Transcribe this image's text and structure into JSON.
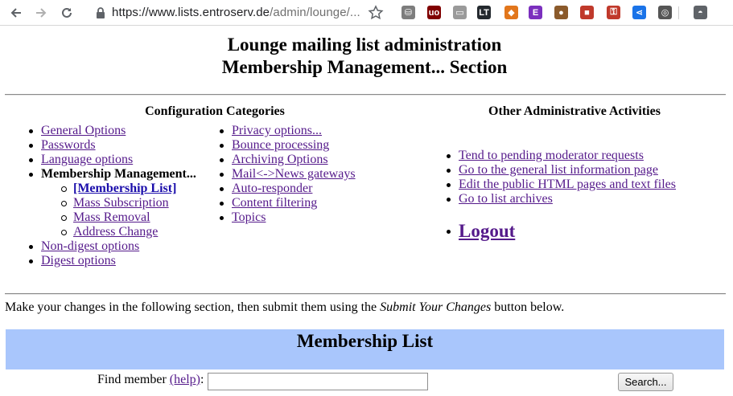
{
  "browser": {
    "url_host": "https://www.lists.entroserv.de",
    "url_path": "/admin/lounge/...",
    "extensions": [
      {
        "name": "stack-ext",
        "glyph": "⛁",
        "color": "#7d7d7d"
      },
      {
        "name": "ublock-ext",
        "glyph": "uo",
        "color": "#800000"
      },
      {
        "name": "page-ext",
        "glyph": "▭",
        "color": "#9a9a9a"
      },
      {
        "name": "languagetool-ext",
        "glyph": "LT",
        "color": "#24292e"
      },
      {
        "name": "metamask-ext",
        "glyph": "◆",
        "color": "#e2761b"
      },
      {
        "name": "e-ext",
        "glyph": "E",
        "color": "#7b2fbe"
      },
      {
        "name": "cookie-ext",
        "glyph": "●",
        "color": "#8b5a2b"
      },
      {
        "name": "record-ext",
        "glyph": "■",
        "color": "#c0392b"
      },
      {
        "name": "key-ext",
        "glyph": "⚿",
        "color": "#c0392b"
      },
      {
        "name": "share-ext",
        "glyph": "⋖",
        "color": "#1a73e8"
      },
      {
        "name": "film-ext",
        "glyph": "◎",
        "color": "#555555"
      },
      {
        "name": "incognito-ext",
        "glyph": "◓",
        "color": "#5f6368"
      }
    ]
  },
  "header": {
    "title_line1": "Lounge mailing list administration",
    "title_line2": "Membership Management... Section"
  },
  "config": {
    "heading": "Configuration Categories",
    "col1": [
      {
        "label": "General Options",
        "type": "link"
      },
      {
        "label": "Passwords",
        "type": "link"
      },
      {
        "label": "Language options",
        "type": "link"
      },
      {
        "label": "Membership Management...",
        "type": "current"
      },
      {
        "label": "[Membership List]",
        "type": "sub-current"
      },
      {
        "label": "Mass Subscription",
        "type": "sub"
      },
      {
        "label": "Mass Removal",
        "type": "sub"
      },
      {
        "label": "Address Change",
        "type": "sub"
      },
      {
        "label": "Non-digest options",
        "type": "link"
      },
      {
        "label": "Digest options",
        "type": "link"
      }
    ],
    "col2": [
      {
        "label": "Privacy options..."
      },
      {
        "label": "Bounce processing"
      },
      {
        "label": "Archiving Options"
      },
      {
        "label": "Mail<->News gateways"
      },
      {
        "label": "Auto-responder"
      },
      {
        "label": "Content filtering"
      },
      {
        "label": "Topics"
      }
    ]
  },
  "other": {
    "heading": "Other Administrative Activities",
    "links": [
      {
        "label": "Tend to pending moderator requests"
      },
      {
        "label": "Go to the general list information page"
      },
      {
        "label": "Edit the public HTML pages and text files"
      },
      {
        "label": "Go to list archives"
      }
    ],
    "logout": "Logout"
  },
  "intro": {
    "before": "Make your changes in the following section, then submit them using the ",
    "emph": "Submit Your Changes",
    "after": " button below."
  },
  "membership": {
    "heading": "Membership List",
    "find_label_before": "Find member ",
    "help_link": "(help)",
    "find_label_after": ":",
    "find_value": "",
    "search_button": "Search..."
  },
  "colors": {
    "link_visited": "#551a8b",
    "link": "#1a0dab",
    "banner": "#a9c6fc"
  }
}
